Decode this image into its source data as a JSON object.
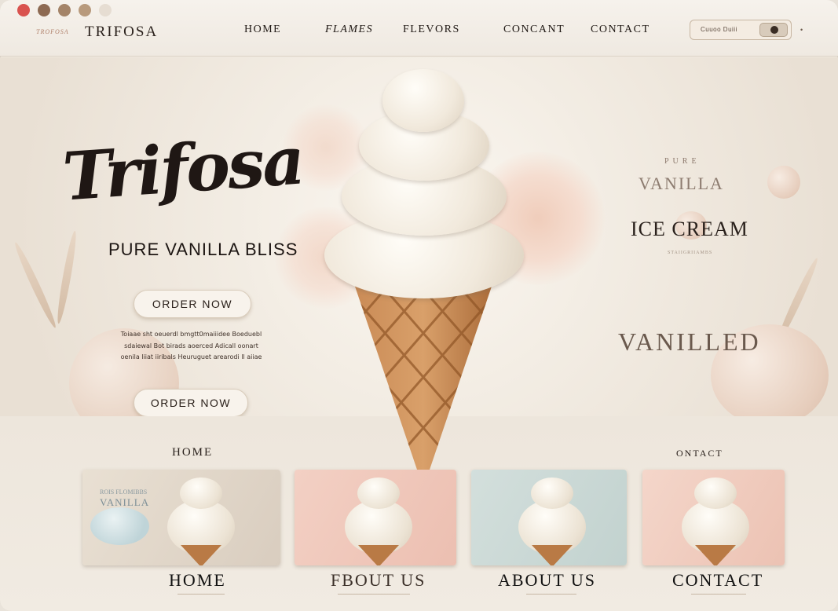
{
  "window": {
    "controls": [
      "close",
      "minimize",
      "zoom",
      "extra",
      "extra"
    ]
  },
  "header": {
    "brand_small": "TROFOSA",
    "brand": "TRIFOSA",
    "nav": [
      "HOME",
      "FLAMES",
      "FLEVORS",
      "CONCANT",
      "CONTACT"
    ],
    "login_label": "Cuuoo  Duiii",
    "menu_glyph": "•"
  },
  "hero": {
    "logo_script": "Trifosa",
    "tagline": "PURE VANILLA BLISS",
    "cta_primary": "ORDER NOW",
    "cta_secondary": "ORDER NOW",
    "blurb": "Toiaae sht oeuerdl bmgtt0maiiidee Boeduebl sdaiewal Bot birads aoerced Adicall oonart oenila liiat iiribals Heuruguet arearodi ll aiiae",
    "side_pure": "PURE",
    "side_vanilla": "VANILLA",
    "side_ice_cream": "ICE CREAM",
    "side_sub": "STAIIGRIIAMBS",
    "side_vanilled": "VANILLED"
  },
  "bottom": {
    "section_left": "HOME",
    "section_right": "ONTACT",
    "cards": [
      {
        "caption": "HOME",
        "bg": "#e3d9cc",
        "text_small": "ROIS  FLOMIBBS",
        "text_big": "VANILLA"
      },
      {
        "caption": "FBOUT US",
        "bg": "#f0c9bd"
      },
      {
        "caption": "ABOUT US",
        "bg": "#c9d7d4"
      },
      {
        "caption": "CONTACT",
        "bg": "#f1cdbf"
      }
    ]
  },
  "colors": {
    "background": "#efe9e0",
    "accent_dark": "#2a211c",
    "cone": "#b97a45",
    "blush": "#f0c9bd",
    "mint": "#c9d7d4"
  },
  "icons": [
    "window-close-icon",
    "window-minimize-icon",
    "window-zoom-icon",
    "toggle-icon",
    "menu-icon"
  ]
}
